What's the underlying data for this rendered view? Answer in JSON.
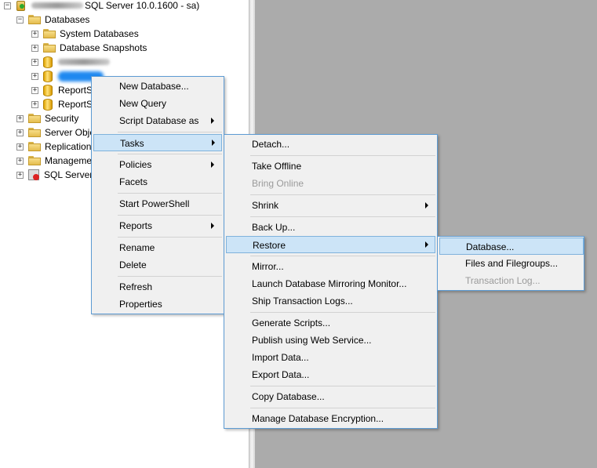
{
  "object_explorer": {
    "server_label": "SQL Server 10.0.1600 - sa)",
    "nodes": [
      {
        "label": "Databases"
      },
      {
        "label": "System Databases"
      },
      {
        "label": "Database Snapshots"
      },
      {
        "label": "ReportS"
      },
      {
        "label": "ReportS"
      },
      {
        "label": "Security"
      },
      {
        "label": "Server Obje"
      },
      {
        "label": "Replication"
      },
      {
        "label": "Manageme"
      },
      {
        "label": "SQL Server"
      }
    ]
  },
  "context_menu": {
    "items": [
      "New Database...",
      "New Query",
      "Script Database as",
      "Tasks",
      "Policies",
      "Facets",
      "Start PowerShell",
      "Reports",
      "Rename",
      "Delete",
      "Refresh",
      "Properties"
    ]
  },
  "tasks_menu": {
    "items": [
      "Detach...",
      "Take Offline",
      "Bring Online",
      "Shrink",
      "Back Up...",
      "Restore",
      "Mirror...",
      "Launch Database Mirroring Monitor...",
      "Ship Transaction Logs...",
      "Generate Scripts...",
      "Publish using Web Service...",
      "Import Data...",
      "Export Data...",
      "Copy Database...",
      "Manage Database Encryption..."
    ]
  },
  "restore_menu": {
    "items": [
      "Database...",
      "Files and Filegroups...",
      "Transaction Log..."
    ]
  },
  "colors": {
    "highlight": "#cce4f7",
    "menu_border": "#5d9bd3",
    "workspace": "#ababab"
  }
}
